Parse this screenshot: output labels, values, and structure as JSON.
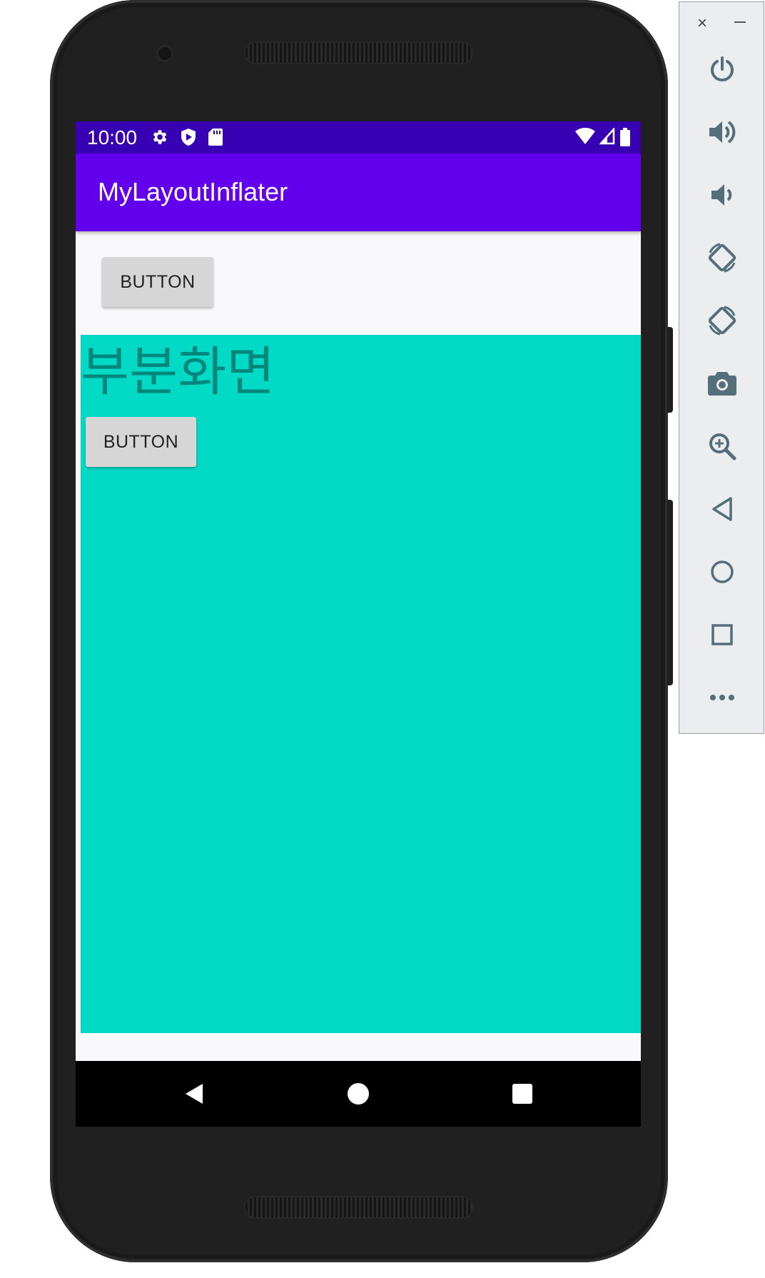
{
  "status_bar": {
    "time": "10:00",
    "left_icons": [
      "settings-icon",
      "shield-play-icon",
      "sd-card-icon"
    ],
    "right_icons": [
      "wifi-icon",
      "cell-signal-icon",
      "battery-icon"
    ]
  },
  "app_bar": {
    "title": "MyLayoutInflater"
  },
  "main": {
    "button_label": "BUTTON"
  },
  "sub_layout": {
    "title": "부분화면",
    "button_label": "BUTTON",
    "background_color": "#03dac5"
  },
  "nav_bar": {
    "buttons": [
      "back-icon",
      "home-icon",
      "recents-icon"
    ]
  },
  "emulator_toolbar": {
    "close_label": "×",
    "tools": [
      "power-icon",
      "volume-up-icon",
      "volume-down-icon",
      "rotate-left-icon",
      "rotate-right-icon",
      "camera-icon",
      "zoom-icon",
      "back-icon",
      "home-icon",
      "overview-icon",
      "more-icon"
    ]
  },
  "colors": {
    "status_bar": "#3700b3",
    "app_bar": "#6200ee",
    "sub_panel": "#03dac5",
    "sub_title_text": "#01877b"
  }
}
